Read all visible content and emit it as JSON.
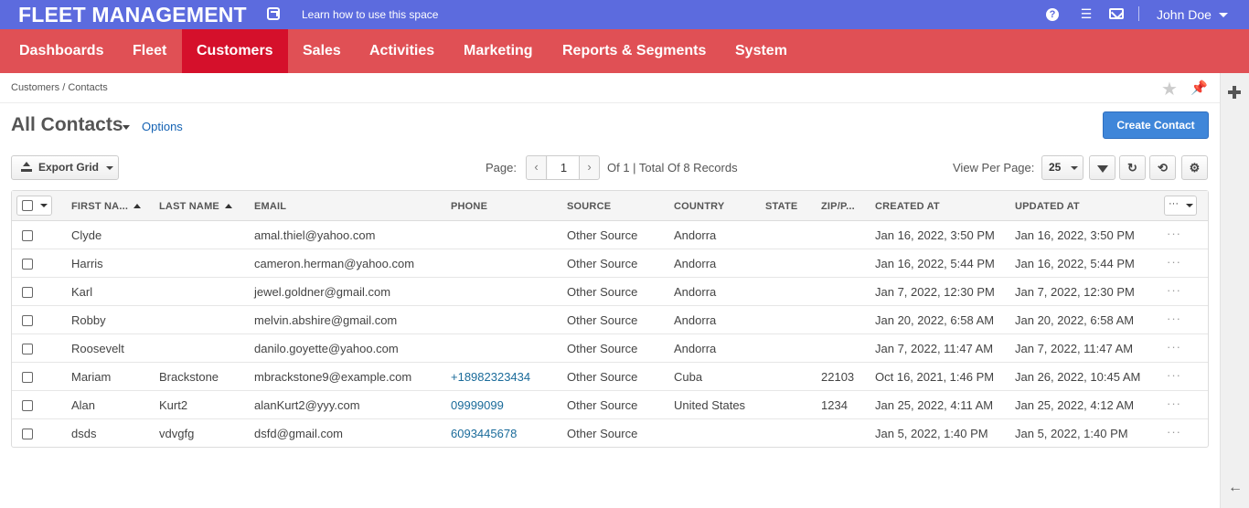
{
  "app": {
    "brand": "FLEET MANAGEMENT",
    "learn_link": "Learn how to use this space",
    "user_name": "John Doe"
  },
  "icons": {
    "help": "question-icon",
    "menu": "hamburger-icon",
    "mail": "envelope-icon",
    "favorite": "star-icon",
    "pin": "pin-icon",
    "add": "plus-icon",
    "collapse": "arrow-left-icon"
  },
  "nav": {
    "items": [
      "Dashboards",
      "Fleet",
      "Customers",
      "Sales",
      "Activities",
      "Marketing",
      "Reports & Segments",
      "System"
    ],
    "active": "Customers"
  },
  "breadcrumb": "Customers / Contacts",
  "page": {
    "title": "All Contacts",
    "options_link": "Options",
    "create_button": "Create Contact"
  },
  "toolbar": {
    "export_label": "Export Grid",
    "page_label": "Page:",
    "page_current": "1",
    "of_label": "Of 1 |  Total Of 8 Records",
    "view_per_page_label": "View Per Page:",
    "view_per_page_value": "25"
  },
  "grid": {
    "columns": [
      "FIRST NA...",
      "LAST NAME",
      "EMAIL",
      "PHONE",
      "SOURCE",
      "COUNTRY",
      "STATE",
      "ZIP/P...",
      "CREATED AT",
      "UPDATED AT"
    ],
    "header_actions": "···",
    "rows": [
      [
        "Clyde",
        "",
        "amal.thiel@yahoo.com",
        "",
        "Other Source",
        "Andorra",
        "",
        "",
        "Jan 16, 2022, 3:50 PM",
        "Jan 16, 2022, 3:50 PM"
      ],
      [
        "Harris",
        "",
        "cameron.herman@yahoo.com",
        "",
        "Other Source",
        "Andorra",
        "",
        "",
        "Jan 16, 2022, 5:44 PM",
        "Jan 16, 2022, 5:44 PM"
      ],
      [
        "Karl",
        "",
        "jewel.goldner@gmail.com",
        "",
        "Other Source",
        "Andorra",
        "",
        "",
        "Jan 7, 2022, 12:30 PM",
        "Jan 7, 2022, 12:30 PM"
      ],
      [
        "Robby",
        "",
        "melvin.abshire@gmail.com",
        "",
        "Other Source",
        "Andorra",
        "",
        "",
        "Jan 20, 2022, 6:58 AM",
        "Jan 20, 2022, 6:58 AM"
      ],
      [
        "Roosevelt",
        "",
        "danilo.goyette@yahoo.com",
        "",
        "Other Source",
        "Andorra",
        "",
        "",
        "Jan 7, 2022, 11:47 AM",
        "Jan 7, 2022, 11:47 AM"
      ],
      [
        "Mariam",
        "Brackstone",
        "mbrackstone9@example.com",
        "+18982323434",
        "Other Source",
        "Cuba",
        "",
        "22103",
        "Oct 16, 2021, 1:46 PM",
        "Jan 26, 2022, 10:45 AM"
      ],
      [
        "Alan",
        "Kurt2",
        "alanKurt2@yyy.com",
        "09999099",
        "Other Source",
        "United States",
        "",
        "1234",
        "Jan 25, 2022, 4:11 AM",
        "Jan 25, 2022, 4:12 AM"
      ],
      [
        "dsds",
        "vdvgfg",
        "dsfd@gmail.com",
        "6093445678",
        "Other Source",
        "",
        "",
        "",
        "Jan 5, 2022, 1:40 PM",
        "Jan 5, 2022, 1:40 PM"
      ]
    ],
    "row_actions": "···"
  },
  "colors": {
    "topbar": "#5c6bde",
    "navbar": "#e05055",
    "nav_active": "#d5102b",
    "primary_button": "#3f86d9",
    "link": "#1462b3"
  }
}
